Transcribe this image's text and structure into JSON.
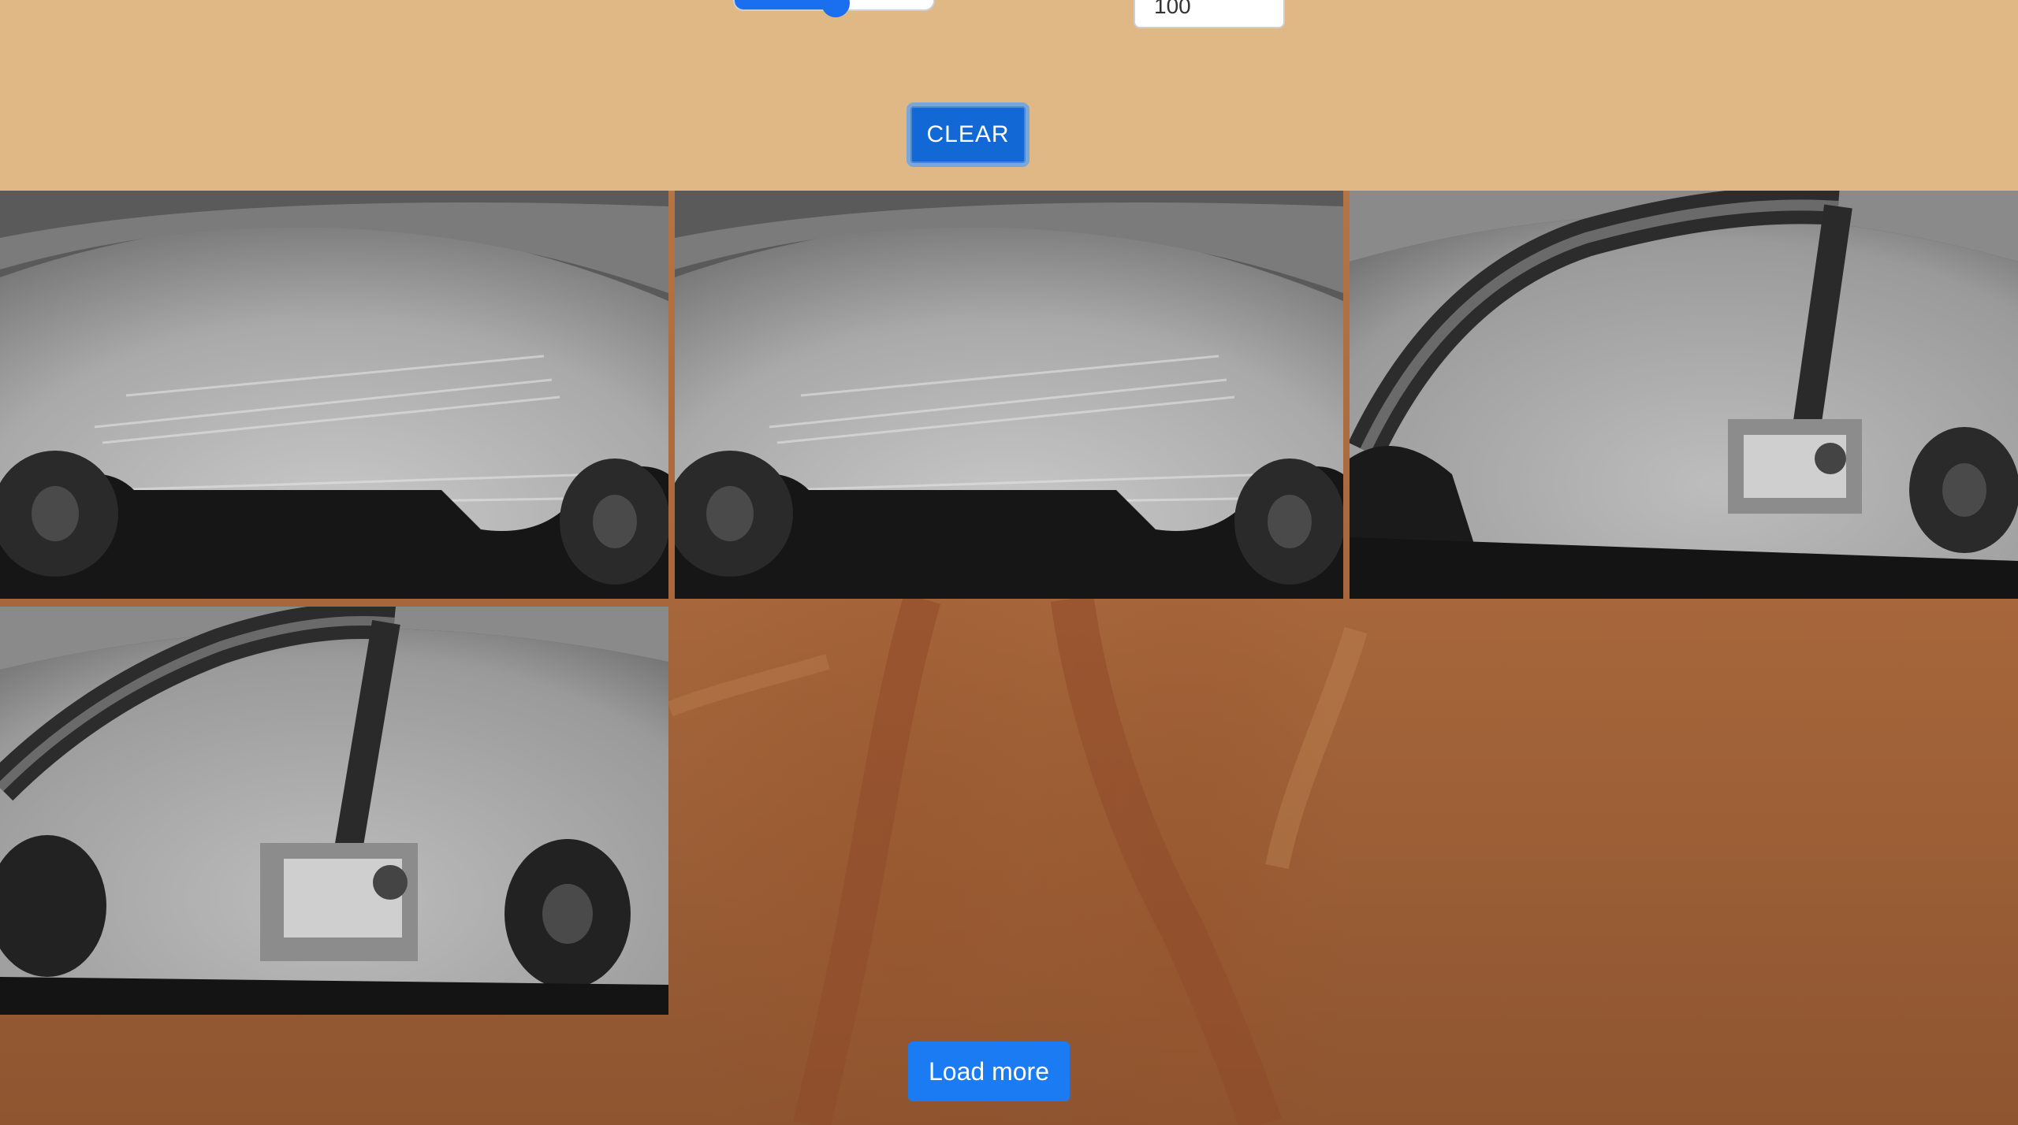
{
  "controls": {
    "slider_value_fraction": 0.5,
    "number_input_value": "100",
    "clear_label": "CLEAR"
  },
  "gallery": {
    "photos": [
      {
        "scene": "hazcam-ground-tracks"
      },
      {
        "scene": "hazcam-ground-tracks"
      },
      {
        "scene": "hazcam-robotic-arm"
      },
      {
        "scene": "hazcam-robotic-arm"
      }
    ]
  },
  "footer": {
    "load_more_label": "Load more"
  },
  "colors": {
    "panel_background": "#dfb886",
    "button_blue": "#1a7bf2",
    "mars_surface": "#a9683c"
  }
}
